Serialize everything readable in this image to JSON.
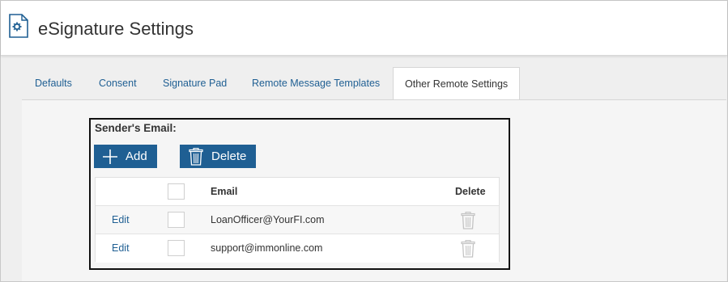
{
  "header": {
    "icon": "settings-document-icon",
    "title": "eSignature Settings"
  },
  "tabs": [
    {
      "label": "Defaults",
      "active": false
    },
    {
      "label": "Consent",
      "active": false
    },
    {
      "label": "Signature Pad",
      "active": false
    },
    {
      "label": "Remote Message Templates",
      "active": false
    },
    {
      "label": "Other Remote Settings",
      "active": true
    }
  ],
  "senders_email": {
    "label": "Sender's Email:",
    "add_button": {
      "label": "Add",
      "icon": "plus-icon"
    },
    "delete_button": {
      "label": "Delete",
      "icon": "trash-icon"
    },
    "table": {
      "columns": [
        "",
        "",
        "Email",
        "Delete"
      ],
      "rows": [
        {
          "action": "Edit",
          "email": "LoanOfficer@YourFI.com",
          "checked": false
        },
        {
          "action": "Edit",
          "email": "support@immonline.com",
          "checked": false
        }
      ]
    }
  },
  "colors": {
    "accent": "#1f5f93",
    "highlight_border": "#111111"
  }
}
